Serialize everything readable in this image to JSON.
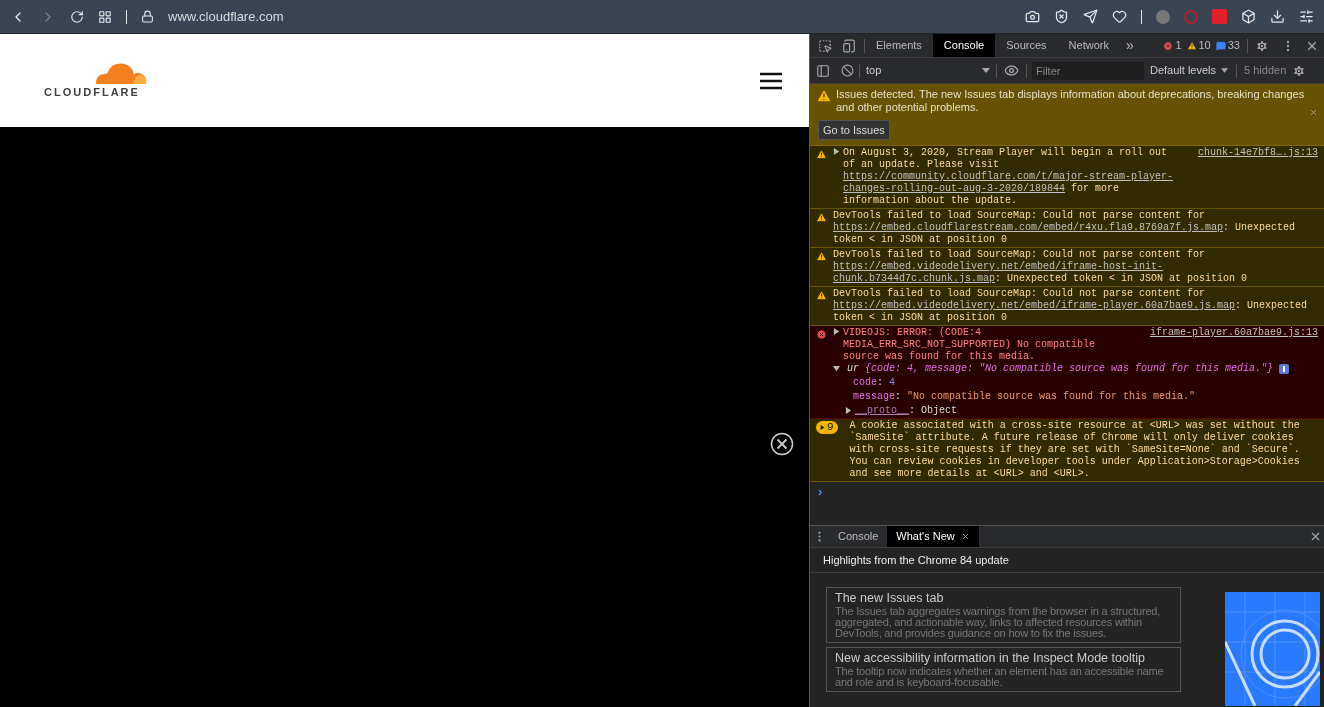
{
  "browser": {
    "url": "www.cloudflare.com"
  },
  "page": {
    "logo_text": "CLOUDFLARE"
  },
  "devtools": {
    "tabs": [
      {
        "label": "Elements",
        "selected": false
      },
      {
        "label": "Console",
        "selected": true
      },
      {
        "label": "Sources",
        "selected": false
      },
      {
        "label": "Network",
        "selected": false
      }
    ],
    "more_tabs": "»",
    "counts": [
      {
        "kind": "error",
        "value": "1"
      },
      {
        "kind": "warning",
        "value": "10"
      },
      {
        "kind": "info",
        "value": "33"
      }
    ],
    "context": "top",
    "filter": {
      "placeholder": "Filter"
    },
    "levels": "Default levels",
    "hidden": "5 hidden",
    "banner": {
      "text": "Issues detected. The new Issues tab displays information about deprecations, breaking changes and other potential problems.",
      "button": "Go to Issues"
    },
    "messages": [
      {
        "kind": "warning",
        "expanded": false,
        "source": "chunk-14e7bf8….js:13",
        "parts": [
          {
            "text": "On August 3, 2020, Stream Player will begin a roll out of an update. Please visit "
          },
          {
            "text": "https://community.cloudflare.com/t/major-stream-player-changes-rolling-out-aug-3-2020/189844",
            "link": true
          },
          {
            "text": " for more information about the update."
          }
        ]
      },
      {
        "kind": "warning",
        "parts": [
          {
            "text": "DevTools failed to load SourceMap: Could not parse content for "
          },
          {
            "text": "https://embed.cloudflarestream.com/embed/r4xu.fla9.8769a7f.js.map",
            "link": true
          },
          {
            "text": ": Unexpected token < in JSON at position 0"
          }
        ]
      },
      {
        "kind": "warning",
        "parts": [
          {
            "text": "DevTools failed to load SourceMap: Could not parse content for "
          },
          {
            "text": "https://embed.videodelivery.net/embed/iframe-host-init-chunk.b7344d7c.chunk.js.map",
            "link": true
          },
          {
            "text": ": Unexpected token < in JSON at position 0"
          }
        ]
      },
      {
        "kind": "warning",
        "parts": [
          {
            "text": "DevTools failed to load SourceMap: Could not parse content for "
          },
          {
            "text": "https://embed.videodelivery.net/embed/iframe-player.60a7bae9.js.map",
            "link": true
          },
          {
            "text": ": Unexpected token < in JSON at position 0"
          }
        ]
      },
      {
        "kind": "error",
        "expanded": false,
        "source": "iframe-player.60a7bae9.js:13",
        "parts": [
          {
            "text": "VIDEOJS: ERROR: (CODE:4 MEDIA_ERR_SRC_NOT_SUPPORTED) No compatible source was found for this media."
          }
        ],
        "object": {
          "expanded": true,
          "name": "ur",
          "separator": ":",
          "preview": "{code: 4, message: \"No compatible source was found for this media.\"}",
          "properties": [
            {
              "key": "code",
              "value": "4",
              "kind": "number"
            },
            {
              "key": "message",
              "value": "\"No compatible source was found for this media.\"",
              "kind": "string"
            }
          ],
          "proto": {
            "key": "__proto__",
            "value": "Object",
            "expanded": false
          }
        }
      },
      {
        "kind": "group",
        "count": "9",
        "expanded": false,
        "parts": [
          {
            "text": "A cookie associated with a cross-site resource at <URL> was set without the `SameSite` attribute. A future release of Chrome will only deliver cookies with cross-site requests if they are set with `SameSite=None` and `Secure`. You can review cookies in developer tools under Application>Storage>Cookies and see more details at <URL> and <URL>."
          }
        ]
      }
    ],
    "prompt": "›",
    "drawer": {
      "tabs": [
        {
          "label": "Console",
          "selected": false,
          "closable": false
        },
        {
          "label": "What's New",
          "selected": true,
          "closable": true
        }
      ],
      "heading": "Highlights from the Chrome 84 update",
      "cards": [
        {
          "title": "The new Issues tab",
          "body": "The Issues tab aggregates warnings from the browser in a structured, aggregated, and actionable way, links to affected resources within DevTools, and provides guidance on how to fix the issues."
        },
        {
          "title": "New accessibility information in the Inspect Mode tooltip",
          "body": "The tooltip now indicates whether an element has an accessible name and role and is keyboard-focusable."
        }
      ]
    }
  }
}
